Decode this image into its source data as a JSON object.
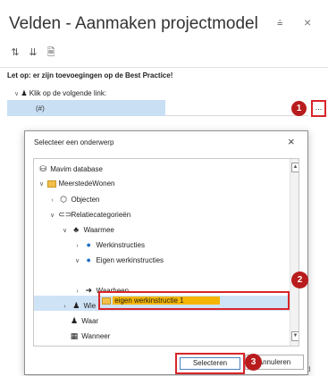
{
  "panel": {
    "title": "Velden - Aanmaken projectmodel",
    "pin_glyph": "⩮",
    "close_glyph": "×",
    "toolbar_icons": [
      "sort-icon",
      "sort-az-icon",
      "export-icon"
    ],
    "notice": "Let op: er zijn toevoegingen op de Best Practice!",
    "tree_row": "Klik op de volgende link:",
    "value": "(#)",
    "ellipsis": "...",
    "bottom_fragment": "d"
  },
  "callouts": [
    "1",
    "2",
    "3"
  ],
  "dialog": {
    "title": "Selecteer een onderwerp",
    "close": "×",
    "tree": [
      {
        "label": "Mavim database",
        "icon": "database-icon",
        "chevron": ""
      },
      {
        "label": "MeerstedeWonen",
        "icon": "folder-icon",
        "chevron": "∨"
      },
      {
        "label": "Objecten",
        "icon": "cube-icon",
        "chevron": "›"
      },
      {
        "label": "Relatiecategorieën",
        "icon": "link-icon",
        "chevron": "∨"
      },
      {
        "label": "Waarmee",
        "icon": "network-icon",
        "chevron": "∨"
      },
      {
        "label": "Werkinstructies",
        "icon": "info-icon",
        "chevron": "›"
      },
      {
        "label": "Eigen werkinstructies",
        "icon": "info-icon",
        "chevron": "∨"
      },
      {
        "label": "eigen werkinstructie 1",
        "icon": "folder-icon",
        "chevron": ""
      },
      {
        "label": "Waarheen",
        "icon": "arrow-right-icon",
        "chevron": "›"
      },
      {
        "label": "Wie",
        "icon": "person-icon",
        "chevron": "›"
      },
      {
        "label": "Waar",
        "icon": "person-icon",
        "chevron": ""
      },
      {
        "label": "Wanneer",
        "icon": "calendar-icon",
        "chevron": ""
      }
    ],
    "buttons": {
      "select": "Selecteren",
      "cancel": "Annuleren"
    }
  }
}
